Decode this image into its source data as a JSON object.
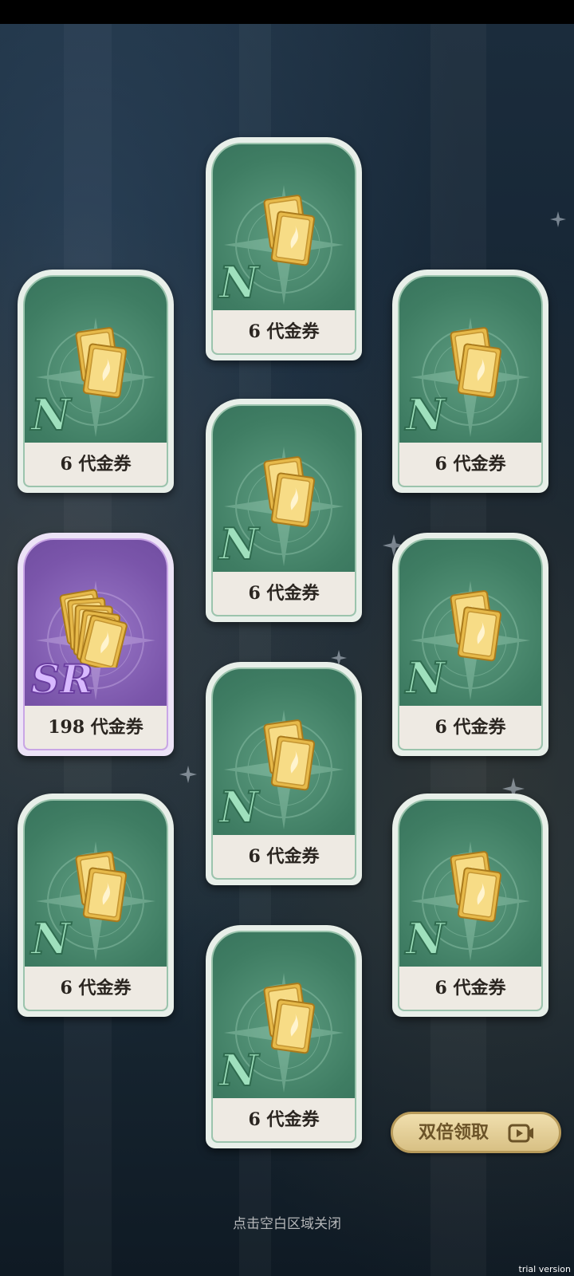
{
  "rewards": [
    {
      "rarity": "N",
      "label": "6 代金券",
      "icon": "ticket-icon"
    },
    {
      "rarity": "N",
      "label": "6 代金券",
      "icon": "ticket-icon"
    },
    {
      "rarity": "N",
      "label": "6 代金券",
      "icon": "ticket-icon"
    },
    {
      "rarity": "N",
      "label": "6 代金券",
      "icon": "ticket-icon"
    },
    {
      "rarity": "SR",
      "label": "198 代金券",
      "icon": "ticket-stack-icon"
    },
    {
      "rarity": "N",
      "label": "6 代金券",
      "icon": "ticket-icon"
    },
    {
      "rarity": "N",
      "label": "6 代金券",
      "icon": "ticket-icon"
    },
    {
      "rarity": "N",
      "label": "6 代金券",
      "icon": "ticket-icon"
    },
    {
      "rarity": "N",
      "label": "6 代金券",
      "icon": "ticket-icon"
    },
    {
      "rarity": "N",
      "label": "6 代金券",
      "icon": "ticket-icon"
    }
  ],
  "double_claim": {
    "label": "双倍领取",
    "icon": "video-play-icon"
  },
  "close_hint": "点击空白区域关闭",
  "watermark": "trial version"
}
